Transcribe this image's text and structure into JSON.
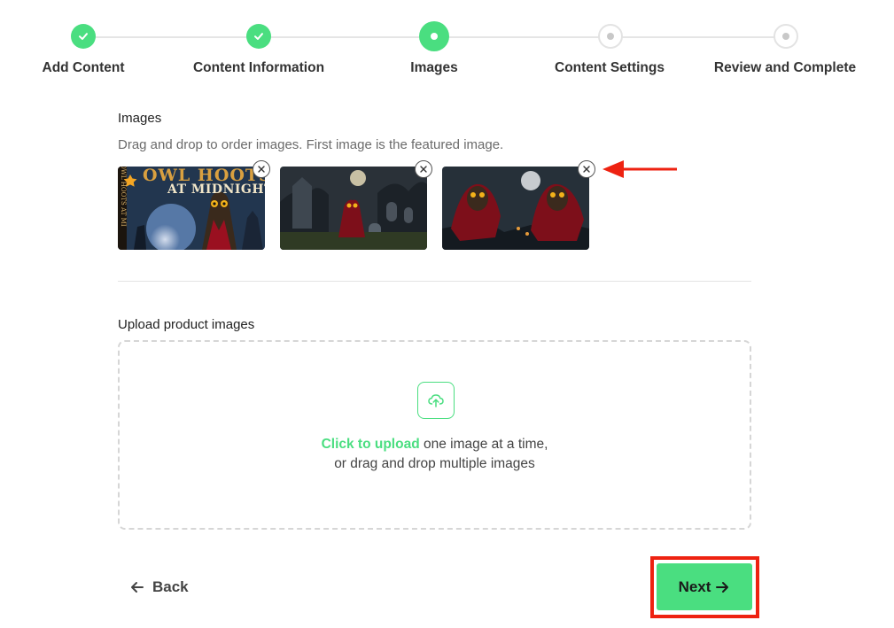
{
  "stepper": {
    "steps": [
      {
        "label": "Add Content",
        "state": "completed"
      },
      {
        "label": "Content Information",
        "state": "completed"
      },
      {
        "label": "Images",
        "state": "active"
      },
      {
        "label": "Content Settings",
        "state": "upcoming"
      },
      {
        "label": "Review and Complete",
        "state": "upcoming"
      }
    ]
  },
  "images_section": {
    "title": "Images",
    "hint": "Drag and drop to order images. First image is the featured image.",
    "images": [
      {
        "cover_line1": "OWL HOOTS",
        "cover_line2": "AT MIDNIGHT",
        "spine_text": "OWL HOOTS AT MI",
        "featured": true
      },
      {
        "featured": false
      },
      {
        "featured": false
      }
    ]
  },
  "upload_section": {
    "title": "Upload product images",
    "link_text": "Click to upload",
    "line1_rest": " one image at a time,",
    "line2": "or drag and drop multiple images"
  },
  "footer": {
    "back_label": "Back",
    "next_label": "Next"
  },
  "colors": {
    "accent": "#4ade80",
    "annotation": "#ee2211"
  }
}
